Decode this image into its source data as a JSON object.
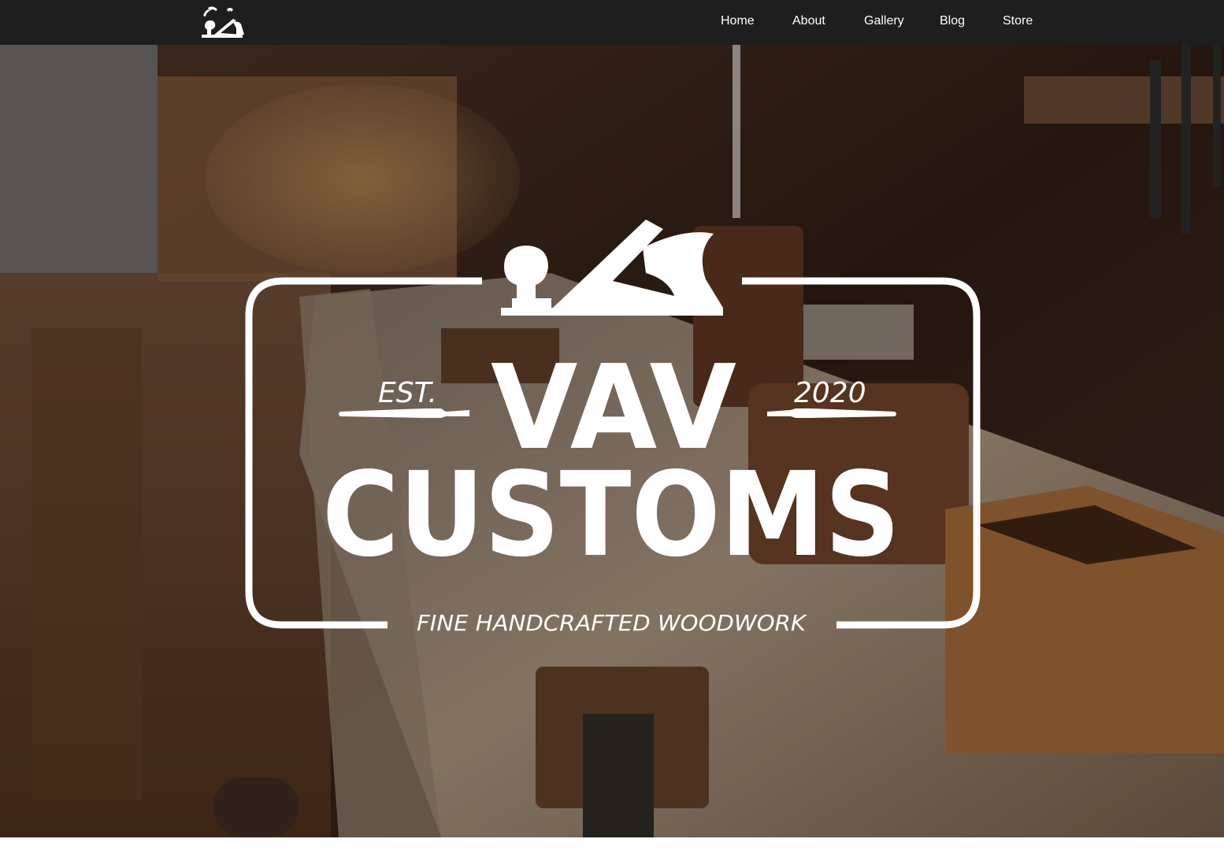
{
  "nav": {
    "logo_icon": "hand-plane-logo-icon",
    "items": [
      {
        "label": "Home"
      },
      {
        "label": "About"
      },
      {
        "label": "Gallery"
      },
      {
        "label": "Blog"
      },
      {
        "label": "Store"
      }
    ]
  },
  "hero": {
    "background": "workshop-workbench-photo",
    "emblem": {
      "icon": "hand-plane-icon",
      "est_label": "EST.",
      "year": "2020",
      "line1": "VAV",
      "line2": "CUSTOMS",
      "tagline": "FINE HANDCRAFTED WOODWORK"
    }
  },
  "colors": {
    "navbar": "#1e1e1e",
    "nav_text": "#ffffff",
    "emblem": "#ffffff"
  }
}
